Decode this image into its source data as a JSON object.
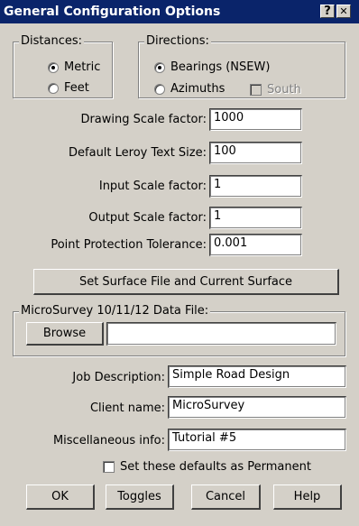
{
  "window": {
    "title": "General Configuration Options",
    "help_glyph": "?",
    "close_glyph": "✕"
  },
  "distances": {
    "legend": "Distances:",
    "options": [
      {
        "label": "Metric",
        "selected": true
      },
      {
        "label": "Feet",
        "selected": false
      }
    ]
  },
  "directions": {
    "legend": "Directions:",
    "options": [
      {
        "label": "Bearings (NSEW)",
        "selected": true
      },
      {
        "label": "Azimuths",
        "selected": false
      }
    ],
    "south": {
      "label": "South",
      "checked": false,
      "enabled": false
    }
  },
  "scale_fields": [
    {
      "label": "Drawing Scale factor:",
      "value": "1000"
    },
    {
      "label": "Default Leroy Text Size:",
      "value": "100"
    },
    {
      "label": "Input Scale factor:",
      "value": "1"
    },
    {
      "label": "Output Scale factor:",
      "value": "1"
    },
    {
      "label": "Point Protection Tolerance:",
      "value": "0.001"
    }
  ],
  "surface_button": "Set Surface File and Current Surface",
  "data_file": {
    "legend": "MicroSurvey 10/11/12 Data File:",
    "browse_label": "Browse",
    "value": ""
  },
  "info_fields": [
    {
      "label": "Job Description:",
      "value": "Simple Road Design"
    },
    {
      "label": "Client name:",
      "value": "MicroSurvey"
    },
    {
      "label": "Miscellaneous info:",
      "value": "Tutorial #5"
    }
  ],
  "permanent": {
    "label": "Set these defaults as Permanent",
    "checked": false
  },
  "buttons": {
    "ok": "OK",
    "toggles": "Toggles",
    "cancel": "Cancel",
    "help": "Help"
  }
}
